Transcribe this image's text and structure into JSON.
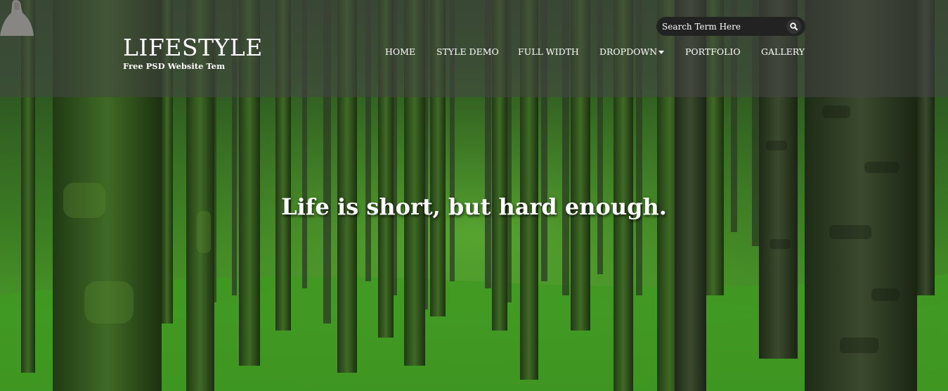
{
  "brand": {
    "title": "LIFESTYLE",
    "tagline": "Free PSD Website Tem"
  },
  "search": {
    "placeholder": "Search Term Here",
    "icon": "magnifier"
  },
  "nav": {
    "items": [
      {
        "label": "HOME"
      },
      {
        "label": "STYLE DEMO"
      },
      {
        "label": "FULL WIDTH"
      },
      {
        "label": "DROPDOWN",
        "has_caret": true
      },
      {
        "label": "PORTFOLIO"
      },
      {
        "label": "GALLERY"
      }
    ]
  },
  "hero": {
    "headline": "Life is short, but hard enough."
  },
  "colors": {
    "header_overlay": "#464646",
    "forest_green": "#3a7a22",
    "search_bg": "#222222",
    "text": "#ffffff"
  }
}
